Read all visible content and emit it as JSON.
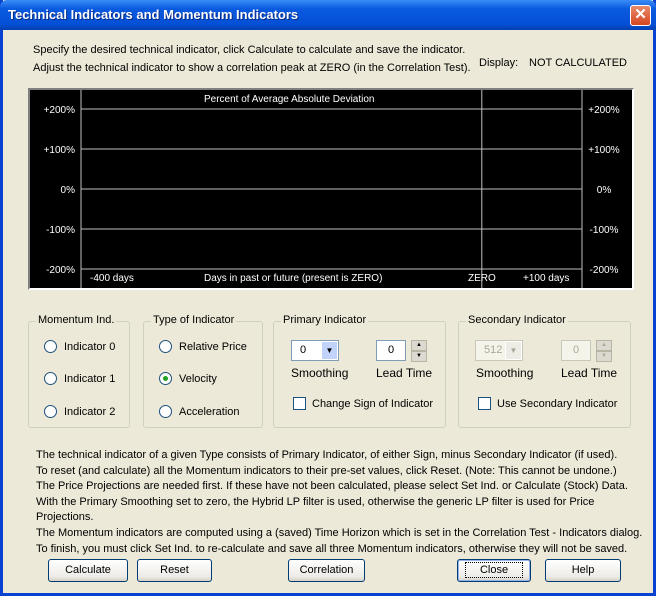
{
  "window": {
    "title": "Technical Indicators and Momentum Indicators",
    "close_glyph": "✕"
  },
  "intro": {
    "line1": "Specify the desired technical indicator, click Calculate to calculate and save the indicator.",
    "line2": "Adjust the technical indicator to show a correlation peak at ZERO (in the Correlation Test).",
    "display_label": "Display:",
    "display_value": "NOT CALCULATED"
  },
  "chart_data": {
    "type": "line",
    "title": "Percent of Average Absolute Deviation",
    "xlabel": "Days in past or future (present is ZERO)",
    "x_left_label": "-400 days",
    "x_zero_label": "ZERO",
    "x_right_label": "+100 days",
    "xlim": [
      -400,
      100
    ],
    "ylim": [
      -200,
      200
    ],
    "yticks": [
      200,
      100,
      0,
      -100,
      -200
    ],
    "ytick_labels": [
      "+200%",
      "+100%",
      "0%",
      "-100%",
      "-200%"
    ],
    "grid": true,
    "series": [],
    "background": "#000000",
    "grid_color": "#c0c0c0"
  },
  "momentum": {
    "label": "Momentum Ind.",
    "items": [
      "Indicator 0",
      "Indicator 1",
      "Indicator 2"
    ],
    "selected": null
  },
  "type": {
    "label": "Type of Indicator",
    "items": [
      "Relative Price",
      "Velocity",
      "Acceleration"
    ],
    "selected": 1
  },
  "primary": {
    "label": "Primary Indicator",
    "smoothing_value": "0",
    "smoothing_label": "Smoothing",
    "lead_value": "0",
    "lead_label": "Lead Time",
    "change_sign_label": "Change Sign of Indicator",
    "change_sign_checked": false
  },
  "secondary": {
    "label": "Secondary Indicator",
    "smoothing_value": "512",
    "smoothing_label": "Smoothing",
    "lead_value": "0",
    "lead_label": "Lead Time",
    "use_label": "Use Secondary Indicator",
    "use_checked": false,
    "enabled": false
  },
  "help_lines": [
    "The technical indicator of a given Type consists of Primary Indicator, of either Sign, minus Secondary Indicator (if used).",
    "To reset (and calculate) all the Momentum indicators to their pre-set values, click Reset.  (Note: This cannot be undone.)",
    "The Price Projections are needed first. If these have not been calculated, please select Set Ind. or Calculate (Stock) Data.",
    "With the Primary Smoothing set to zero, the Hybrid LP filter is used, otherwise the generic LP filter is used for Price Projections.",
    "The Momentum indicators are computed using a (saved) Time Horizon which is set in the Correlation Test - Indicators dialog.",
    "To finish, you must click Set Ind. to re-calculate and save all three Momentum indicators, otherwise they will not be saved."
  ],
  "buttons": {
    "calculate": "Calculate",
    "reset": "Reset",
    "correlation": "Correlation",
    "close": "Close",
    "help": "Help"
  }
}
